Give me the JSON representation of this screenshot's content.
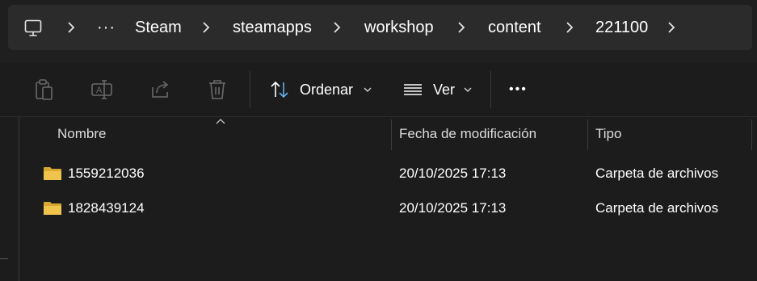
{
  "breadcrumb": {
    "items": [
      "Steam",
      "steamapps",
      "workshop",
      "content",
      "221100"
    ],
    "more_label": "···"
  },
  "toolbar": {
    "sort_label": "Ordenar",
    "view_label": "Ver",
    "more_label": "•••"
  },
  "columns": {
    "name": "Nombre",
    "date": "Fecha de modificación",
    "type": "Tipo"
  },
  "files": [
    {
      "name": "1559212036",
      "date": "20/10/2025 17:13",
      "type": "Carpeta de archivos"
    },
    {
      "name": "1828439124",
      "date": "20/10/2025 17:13",
      "type": "Carpeta de archivos"
    }
  ],
  "colors": {
    "folder": "#f0c44c",
    "accent": "#5fb2f2",
    "background": "#1c1c1c"
  }
}
